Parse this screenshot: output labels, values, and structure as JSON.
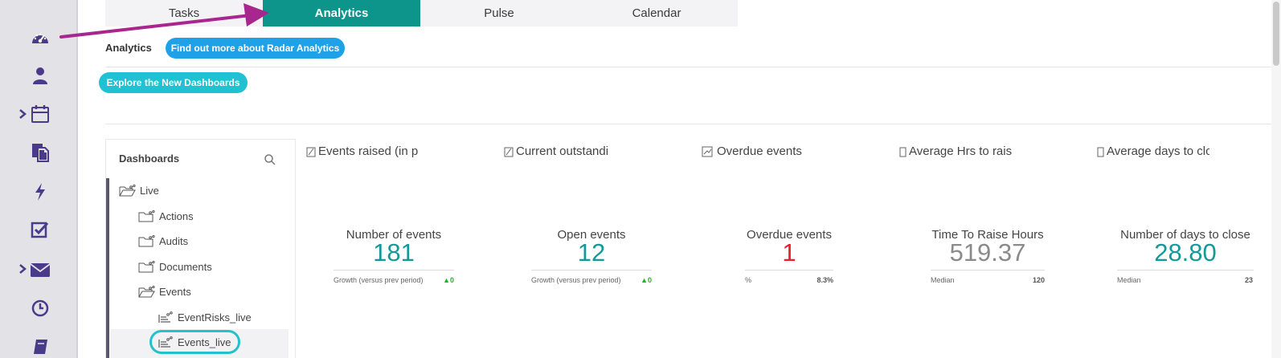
{
  "tabs": [
    {
      "label": "Tasks",
      "active": false
    },
    {
      "label": "Analytics",
      "active": true
    },
    {
      "label": "Pulse",
      "active": false
    },
    {
      "label": "Calendar",
      "active": false
    }
  ],
  "sub_header": {
    "label": "Analytics",
    "find_out_button": "Find out more about Radar Analytics",
    "explore_button": "Explore the New Dashboards"
  },
  "sidebar_rail": {
    "icons": [
      "dashboard-gauge-icon",
      "user-icon",
      "calendar-icon",
      "documents-icon",
      "lightning-icon",
      "task-checkbox-icon",
      "mail-icon",
      "clock-icon",
      "book-icon"
    ]
  },
  "dashboards": {
    "header": "Dashboards",
    "tree": [
      {
        "label": "Live",
        "type": "folder-open"
      },
      {
        "label": "Actions",
        "type": "folder"
      },
      {
        "label": "Audits",
        "type": "folder"
      },
      {
        "label": "Documents",
        "type": "folder"
      },
      {
        "label": "Events",
        "type": "folder-open"
      },
      {
        "label": "EventRisks_live",
        "type": "dashboard"
      },
      {
        "label": "Events_live",
        "type": "dashboard",
        "selected": true
      }
    ]
  },
  "widgets": [
    {
      "title": "Events raised (in p",
      "metric": "Number of events",
      "value": "181",
      "value_color": "#139a98",
      "foot_left": "Growth (versus prev period)",
      "foot_right": "▲0"
    },
    {
      "title": "Current outstandi",
      "metric": "Open events",
      "value": "12",
      "value_color": "#139a98",
      "foot_left": "Growth (versus prev period)",
      "foot_right": "▲0"
    },
    {
      "title": "Overdue events",
      "metric": "Overdue events",
      "value": "1",
      "value_color": "#e8202a",
      "foot_left": "%",
      "foot_right": "8.3%"
    },
    {
      "title": "Average Hrs to rais",
      "metric": "Time To Raise Hours",
      "value": "519.37",
      "value_color": "#8a8a8a",
      "foot_left": "Median",
      "foot_right": "120"
    },
    {
      "title": "Average days to clc",
      "metric": "Number of days to close",
      "value": "28.80",
      "value_color": "#139a98",
      "foot_left": "Median",
      "foot_right": "23"
    }
  ],
  "colors": {
    "accent_tab": "#0d958b",
    "annotation_arrow": "#a8278f",
    "rail_icon": "#4a3a8a"
  }
}
